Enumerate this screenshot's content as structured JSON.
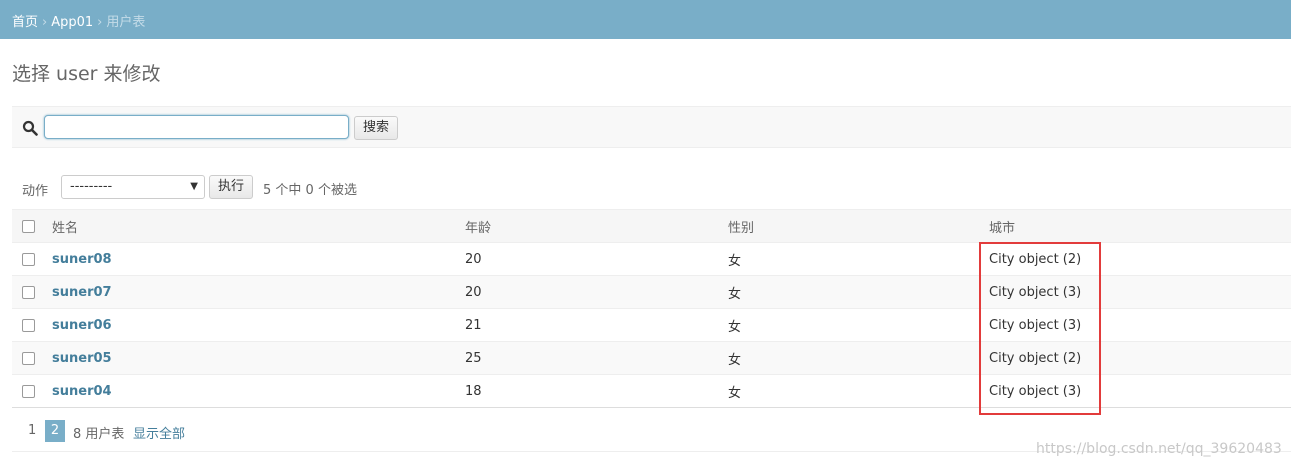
{
  "breadcrumbs": {
    "home": "首页",
    "app": "App01",
    "current": "用户表",
    "separator": "›"
  },
  "page_title": "选择 user 来修改",
  "search": {
    "value": "",
    "button_label": "搜索"
  },
  "actions": {
    "label": "动作",
    "selected_option": "---------",
    "go_label": "执行",
    "selection_counter": "5 个中 0 个被选"
  },
  "table": {
    "headers": {
      "name": "姓名",
      "age": "年龄",
      "sex": "性别",
      "city": "城市"
    },
    "rows": [
      {
        "name": "suner08",
        "age": "20",
        "sex": "女",
        "city": "City object (2)"
      },
      {
        "name": "suner07",
        "age": "20",
        "sex": "女",
        "city": "City object (3)"
      },
      {
        "name": "suner06",
        "age": "21",
        "sex": "女",
        "city": "City object (3)"
      },
      {
        "name": "suner05",
        "age": "25",
        "sex": "女",
        "city": "City object (2)"
      },
      {
        "name": "suner04",
        "age": "18",
        "sex": "女",
        "city": "City object (3)"
      }
    ]
  },
  "pagination": {
    "page1": "1",
    "page2": "2",
    "count_text": "8 用户表",
    "show_all": "显示全部"
  },
  "watermark": "https://blog.csdn.net/qq_39620483",
  "colors": {
    "header_bar": "#79aec8",
    "link": "#447e9b",
    "highlight": "#e23b3b"
  },
  "icons": {
    "search": "search-icon",
    "dropdown": "chevron-down-icon"
  }
}
